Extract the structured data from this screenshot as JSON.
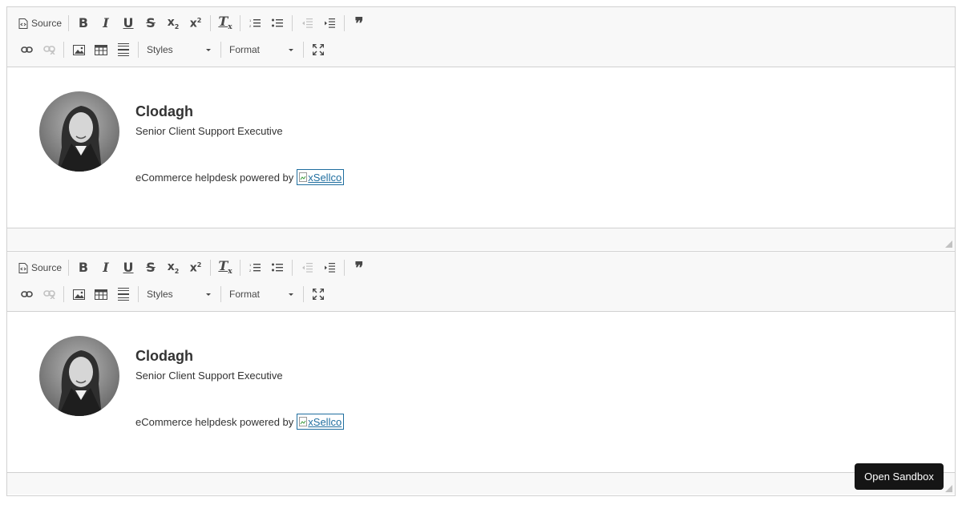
{
  "toolbar": {
    "source_label": "Source",
    "styles_label": "Styles",
    "format_label": "Format",
    "buttons": [
      "source-icon",
      "bold-icon",
      "italic-icon",
      "underline-icon",
      "strikethrough-icon",
      "subscript-icon",
      "superscript-icon",
      "remove-format-icon",
      "numbered-list-icon",
      "bulleted-list-icon",
      "outdent-icon",
      "indent-icon",
      "blockquote-icon",
      "link-icon",
      "unlink-icon",
      "image-icon",
      "table-icon",
      "horizontal-line-icon",
      "maximize-icon"
    ]
  },
  "editors": [
    {
      "signature": {
        "name": "Clodagh",
        "title": "Senior Client Support Executive",
        "powered_by": "eCommerce helpdesk powered by",
        "logo_alt": "xSellco"
      }
    },
    {
      "signature": {
        "name": "Clodagh",
        "title": "Senior Client Support Executive",
        "powered_by": "eCommerce helpdesk powered by",
        "logo_alt": "xSellco"
      }
    }
  ],
  "sandbox_button": "Open Sandbox",
  "colors": {
    "toolbar_bg": "#f8f8f8",
    "border": "#d1d1d1",
    "link": "#1f6e9f",
    "sandbox_bg": "#151515"
  }
}
